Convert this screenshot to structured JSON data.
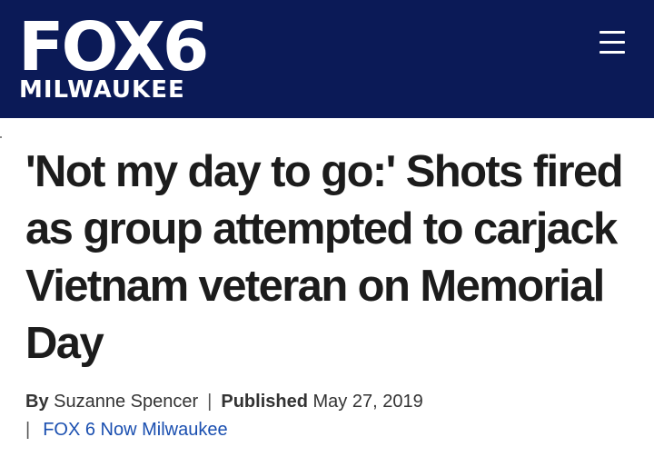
{
  "header": {
    "logo_main": "FOX6",
    "logo_sub": "MILWAUKEE",
    "background_color": "#0b1a57",
    "menu_icon": "hamburger-menu-icon"
  },
  "article": {
    "headline": "'Not my day to go:' Shots fired as group attempted to carjack Vietnam veteran on Memorial Day",
    "byline": {
      "by_label": "By",
      "author": "Suzanne Spencer",
      "separator": "|",
      "published_label": "Published",
      "published_date": "May 27, 2019",
      "source": "FOX 6 Now Milwaukee",
      "link_color": "#1a4fb0"
    }
  }
}
